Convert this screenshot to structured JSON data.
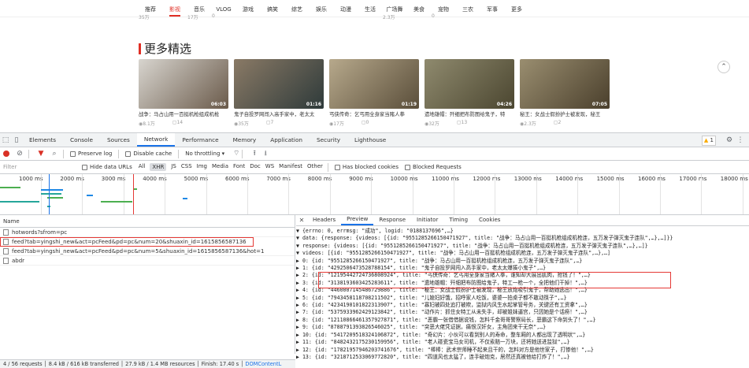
{
  "site": {
    "nav": [
      "推荐",
      "影视",
      "音乐",
      "VLOG",
      "游戏",
      "搞笑",
      "综艺",
      "娱乐",
      "动漫",
      "生活",
      "广场舞",
      "美食",
      "宠物",
      "三农",
      "军事",
      "更多"
    ],
    "nav_active_index": 1,
    "top_stats": [
      "35万",
      "",
      "17万",
      "0",
      "",
      "",
      "",
      "",
      "",
      "",
      "2.3万",
      "",
      "0"
    ],
    "section_title": "更多精选",
    "cards": [
      {
        "title": "战争：马占山用一百挺机枪组成机枪",
        "duration": "06:03",
        "views": "8.1万",
        "comments": "14",
        "colors": [
          "#d8d5cf",
          "#6a5a4a"
        ]
      },
      {
        "title": "鬼子自投罗网闯入高手家中，老太太",
        "duration": "01:16",
        "views": "35万",
        "comments": "7",
        "colors": [
          "#8a7a66",
          "#2e3a3a"
        ]
      },
      {
        "title": "丐侠传奇：乞丐用全身家当赌人拳",
        "duration": "01:19",
        "views": "17万",
        "comments": "0",
        "colors": [
          "#b7a98c",
          "#5a4e3a"
        ]
      },
      {
        "title": "遗地雄帽：歼细把布防图给鬼子，特",
        "duration": "04:26",
        "views": "32万",
        "comments": "13",
        "colors": [
          "#8f8a6e",
          "#4b4630"
        ]
      },
      {
        "title": "秘王：女战士假扮护士被发现，秘王",
        "duration": "07:05",
        "views": "2.3万",
        "comments": "2",
        "colors": [
          "#9a8e70",
          "#4a3f2c"
        ]
      }
    ]
  },
  "devtools": {
    "tabs": [
      "Elements",
      "Console",
      "Sources",
      "Network",
      "Performance",
      "Memory",
      "Application",
      "Security",
      "Lighthouse"
    ],
    "active_tab": "Network",
    "warning_count": "1",
    "toolbar": {
      "preserve_log": "Preserve log",
      "disable_cache": "Disable cache",
      "throttling": "No throttling"
    },
    "filter": {
      "placeholder": "Filter",
      "hide_data_urls": "Hide data URLs",
      "types": [
        "All",
        "XHR",
        "JS",
        "CSS",
        "Img",
        "Media",
        "Font",
        "Doc",
        "WS",
        "Manifest",
        "Other"
      ],
      "selected_type": "XHR",
      "has_blocked_cookies": "Has blocked cookies",
      "blocked_requests": "Blocked Requests"
    },
    "timeline_ticks": [
      "1000 ms",
      "2000 ms",
      "3000 ms",
      "4000 ms",
      "5000 ms",
      "6000 ms",
      "7000 ms",
      "8000 ms",
      "9000 ms",
      "10000 ms",
      "11000 ms",
      "12000 ms",
      "13000 ms",
      "14000 ms",
      "15000 ms",
      "16000 ms",
      "17000 ms",
      "18000 ms"
    ],
    "requests_header": "Name",
    "requests": [
      "hotwords?sfrom=pc",
      "feed?tab=yingshi_new&act=pcFeed&pd=pc&num=20&shuaxin_id=1615856587136",
      "feed?tab=yingshi_new&act=pcFeed&pd=pc&num=5&shuaxin_id=1615856587136&hot=1",
      "abdr"
    ],
    "highlighted_request_index": 1,
    "status_bar": {
      "requests": "4 / 56 requests",
      "transferred": "8.4 kB / 616 kB transferred",
      "resources": "27.9 kB / 1.4 MB resources",
      "finish": "Finish: 17.40 s",
      "dcl": "DOMContentL"
    },
    "detail_tabs": [
      "Headers",
      "Preview",
      "Response",
      "Initiator",
      "Timing",
      "Cookies"
    ],
    "active_detail_tab": "Preview",
    "preview_lines": [
      "▼ {errno: 0, errmsg: \"成功\", logid: \"0188137696\",…}",
      "  ▼ data: {response: {videos: [{id: \"9551285266150471927\", title: \"战争：马占山用一百挺机枪组成机枪连，五万发子弹灭鬼子连队\",…},…]}}",
      "    ▼ response: {videos: [{id: \"9551285266150471927\", title: \"战争：马占山用一百挺机枪组成机枪连，五万发子弹灭鬼子连队\",…},…]}",
      "      ▼ videos: [{id: \"9551285266150471927\", title: \"战争：马占山用一百挺机枪组成机枪连，五万发子弹灭鬼子连队\",…},…]",
      "        ▶ 0: {id: \"9551285266150471927\", title: \"战争：马占山用一百挺机枪组成机枪连，五万发子弹灭鬼子连队\",…}",
      "        ▶ 1: {id: \"4292506473528788154\", title: \"鬼子自投罗网闯入高手家中，老太太爆揍小鬼子\",…}",
      "        ▶ 2: {id: \"12195442724736808924\", title: \"丐侠传奇：乞丐用全身家当赌人拳，谁知却大展出肌肉，抢钱了！\",…}",
      "        ▶ 3: {id: \"3138193603425283611\", title: \"遗地雄帽：歼细把布防图给鬼子，特工一枪一个，全把他们干掉！\",…}",
      "        ▶ 4: {id: \"4460007145486729886\", title: \"秘王：女战士假扮护士被发现，秘王放炮吸引鬼子，帮助她逃出！\",…}",
      "        ▶ 5: {id: \"7943458118708211502\", title: \"儿媳妇好饿，招呼家人吃饭，婆婆一拍桌子都不敢动筷子\",…}",
      "        ▶ 6: {id: \"4234190101822313907\", title: \"寡妇被四处追打被欺，监狱内风生水起掌管号务，关键还有工资拿\",…}",
      "        ▶ 7: {id: \"5375933962429123842\", title: \"动作片：抓住女特工从未失手，却被姐妹逼宫，只因她是个话痨！\",…}",
      "        ▶ 8: {id: \"12110866461357927871\", title: \"恶霸一张借借据说钱，怎料千金哥哥警察局长，恶霸这下命到头了！\",…}",
      "        ▶ 9: {id: \"8788791393826546025\", title: \"突恶大佬凭证据，痛恨汉奸女，主角团来干无奈\",…}",
      "        ▶ 10: {id: \"5417209518324106872\", title: \"奇幻片：小伙可以看到别人的寿命，整车厢的人都出现了透明状\",…}",
      "        ▶ 11: {id: \"8482432175230159956\", title: \"老人碰瓷宝马女司机，不仅索赔一万块，还将她送进监狱\",…}",
      "        ▶ 12: {id: \"17821957946203741676\", title: \"棒棒：武术宗师睡不起来且干的，怎料对方是他世家子，打惨他！\",…}",
      "        ▶ 13: {id: \"3218712533069772820\", title: \"四道风也太猛了，连手破炮克，居然还真被他给打炸了！\",…}"
    ]
  }
}
